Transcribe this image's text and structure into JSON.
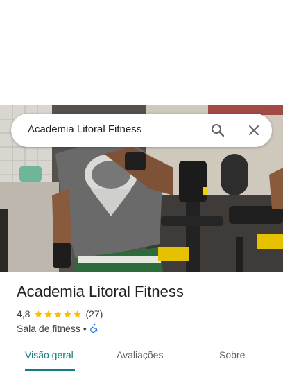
{
  "search": {
    "query": "Academia Litoral Fitness",
    "search_icon": "search-icon",
    "close_icon": "close-icon"
  },
  "place": {
    "name": "Academia Litoral Fitness",
    "rating": "4,8",
    "stars": 5,
    "review_count": "(27)",
    "category": "Sala de fitness",
    "separator": "•",
    "accessibility_icon": "wheelchair-icon",
    "star_color": "#fbbc04"
  },
  "tabs": [
    {
      "label": "Visão geral",
      "active": true
    },
    {
      "label": "Avaliações",
      "active": false
    },
    {
      "label": "Sobre",
      "active": false
    }
  ],
  "colors": {
    "accent": "#0f7c82",
    "accessibility": "#1a73e8"
  }
}
